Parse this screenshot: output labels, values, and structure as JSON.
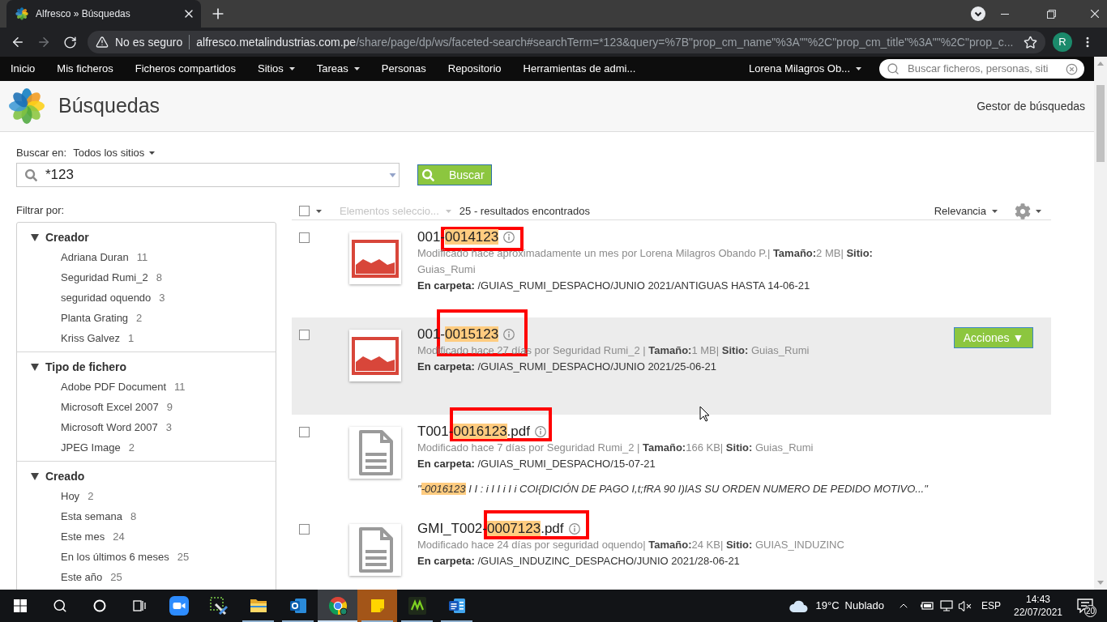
{
  "browser": {
    "tab": {
      "title": "Alfresco » Búsquedas"
    },
    "forward_disabled": true,
    "omnibox": {
      "security": "No es seguro",
      "host": "alfresco.metalindustrias.com.pe",
      "path": "/share/page/dp/ws/faceted-search#searchTerm=*123&query=%7B\"prop_cm_name\"%3A\"\"%2C\"prop_cm_title\"%3A\"\"%2C\"prop_c..."
    },
    "profile": "R"
  },
  "nav": {
    "items": [
      {
        "label": "Inicio",
        "menu": false
      },
      {
        "label": "Mis ficheros",
        "menu": false
      },
      {
        "label": "Ficheros compartidos",
        "menu": false
      },
      {
        "label": "Sitios",
        "menu": true
      },
      {
        "label": "Tareas",
        "menu": true
      },
      {
        "label": "Personas",
        "menu": false
      },
      {
        "label": "Repositorio",
        "menu": false
      },
      {
        "label": "Herramientas de admi...",
        "menu": false
      }
    ],
    "user": "Lorena Milagros Ob...",
    "search": {
      "placeholder": "Buscar ficheros, personas, siti"
    }
  },
  "header": {
    "title": "Búsquedas",
    "link": "Gestor de búsquedas"
  },
  "search": {
    "scope_label": "Buscar en:",
    "scope": "Todos los sitios",
    "value": "*123",
    "button": "Buscar"
  },
  "filters": {
    "title": "Filtrar por:",
    "sections": [
      {
        "title": "Creador",
        "expanded": true,
        "items": [
          {
            "label": "Adriana Duran",
            "count": "11"
          },
          {
            "label": "Seguridad Rumi_2",
            "count": "8"
          },
          {
            "label": "seguridad oquendo",
            "count": "3"
          },
          {
            "label": "Planta Grating",
            "count": "2"
          },
          {
            "label": "Kriss Galvez",
            "count": "1"
          }
        ]
      },
      {
        "title": "Tipo de fichero",
        "expanded": true,
        "items": [
          {
            "label": "Adobe PDF Document",
            "count": "11"
          },
          {
            "label": "Microsoft Excel 2007",
            "count": "9"
          },
          {
            "label": "Microsoft Word 2007",
            "count": "3"
          },
          {
            "label": "JPEG Image",
            "count": "2"
          }
        ]
      },
      {
        "title": "Creado",
        "expanded": true,
        "items": [
          {
            "label": "Hoy",
            "count": "2"
          },
          {
            "label": "Esta semana",
            "count": "8"
          },
          {
            "label": "Este mes",
            "count": "24"
          },
          {
            "label": "En los últimos 6 meses",
            "count": "25"
          },
          {
            "label": "Este año",
            "count": "25"
          }
        ]
      }
    ]
  },
  "results": {
    "select_all": {
      "checked": false
    },
    "selected_menu": {
      "label": "Elementos seleccio...",
      "disabled": true
    },
    "count": "25 - resultados encontrados",
    "sort": "Relevancia",
    "items": [
      {
        "checked": false,
        "hovered": false,
        "marked": true,
        "kind": "image",
        "name": {
          "prefix": "001-",
          "match": "0014123"
        },
        "meta": "Modificado hace aproximadamente un mes por Lorena Milagros Obando P.| **Tamaño:**2 MB| **Sitio:** Guias_Rumi",
        "folder": "**En carpeta:** /GUIAS_RUMI_DESPACHO/JUNIO 2021/ANTIGUAS HASTA 14-06-21"
      },
      {
        "checked": false,
        "hovered": true,
        "marked": true,
        "kind": "image",
        "name": {
          "prefix": "001-",
          "match": "0015123"
        },
        "meta": "Modificado hace 27 días por Seguridad Rumi_2 | **Tamaño:**1 MB| **Sitio:** Guias_Rumi",
        "folder": "**En carpeta:** /GUIAS_RUMI_DESPACHO/JUNIO 2021/25-06-21",
        "actions": "Acciones ▼"
      },
      {
        "checked": false,
        "hovered": false,
        "marked": true,
        "kind": "document",
        "name": {
          "prefix": "T001-",
          "match": "0016123",
          "suffix": ".pdf"
        },
        "meta": "Modificado hace 7 días por Seguridad Rumi_2 | **Tamaño:**166 KB| **Sitio:** Guias_Rumi",
        "folder": "**En carpeta:** /GUIAS_RUMI_DESPACHO/15-07-21",
        "snippet": {
          "open": "\"",
          "match": "-0016123",
          "rest": " I I : i I I i I i COI{DICIÓN DE PAGO I,t;fRA 90 I)IAS SU ORDEN NUMERO DE PEDIDO MOTIVO...\""
        }
      },
      {
        "checked": false,
        "hovered": false,
        "marked": true,
        "kind": "document",
        "name": {
          "prefix": "GMI_T002-",
          "match": "0007123",
          "suffix": ".pdf"
        },
        "meta": "Modificado hace 24 días por seguridad oquendo| **Tamaño:**24 KB| **Sitio:** GUIAS_INDUZINC",
        "folder": "**En carpeta:** /GUIAS_INDUZINC_DESPACHO/JUNIO 2021/28-06-21"
      }
    ]
  },
  "taskbar": {
    "apps": [
      {
        "running": false,
        "selected": false,
        "attention": false
      },
      {
        "running": false,
        "selected": false,
        "attention": false
      },
      {
        "running": true,
        "selected": false,
        "attention": false
      },
      {
        "running": true,
        "selected": false,
        "attention": false
      },
      {
        "running": true,
        "selected": true,
        "attention": false
      },
      {
        "running": true,
        "selected": false,
        "attention": true
      },
      {
        "running": true,
        "selected": false,
        "attention": false
      },
      {
        "running": true,
        "selected": false,
        "attention": false
      }
    ],
    "weather": {
      "temperature": "19°C",
      "condition": "Nublado"
    },
    "volume_muted": true,
    "language": "ESP",
    "time": "14:43",
    "date": "22/07/2021",
    "notifications": "20"
  }
}
